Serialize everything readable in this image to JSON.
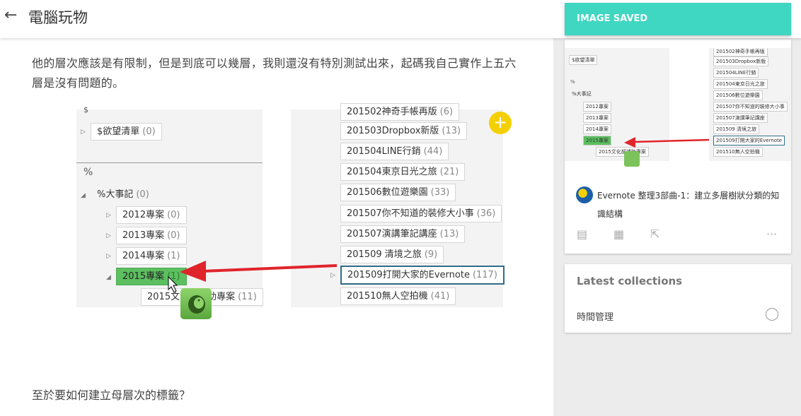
{
  "header": {
    "back_glyph": "←",
    "title": "電腦玩物"
  },
  "article": {
    "paragraph1": "他的層次應該是有限制，但是到底可以幾層，我則還沒有特別測試出來，起碼我自己實作上五六層是沒有問題的。",
    "paragraph2": "至於要如何建立母層次的標籤？"
  },
  "screenshot": {
    "left_tags": [
      {
        "name": "$欲望清單",
        "count": "(0)"
      },
      {
        "name": "%大事記",
        "count": "(0)"
      },
      {
        "name": "2012專案",
        "count": "(0)"
      },
      {
        "name": "2013專案",
        "count": "(0)"
      },
      {
        "name": "2014專案",
        "count": "(1)"
      },
      {
        "name": "2015專案",
        "count": "(1)"
      },
      {
        "name": "2015文化部補助專案",
        "count": "(11)"
      }
    ],
    "left_headers": [
      "$",
      "%"
    ],
    "right_tags": [
      {
        "name": "201502神奇手帳再版",
        "count": "(6)"
      },
      {
        "name": "201503Dropbox新版",
        "count": "(13)"
      },
      {
        "name": "201504LINE行銷",
        "count": "(44)"
      },
      {
        "name": "201504東京日光之旅",
        "count": "(21)"
      },
      {
        "name": "201506數位遊樂園",
        "count": "(33)"
      },
      {
        "name": "201507你不知道的裝修大小事",
        "count": "(36)"
      },
      {
        "name": "201507演講筆記講座",
        "count": "(13)"
      },
      {
        "name": "201509 清境之旅",
        "count": "(9)"
      },
      {
        "name": "201509打開大家的Evernote",
        "count": "(117)"
      },
      {
        "name": "201510無人空拍機",
        "count": "(41)"
      }
    ],
    "plus_glyph": "+"
  },
  "toast": {
    "label": "IMAGE SAVED"
  },
  "saved_card": {
    "title": "Evernote 整理3部曲-1：建立多層樹狀分類的知識結構",
    "actions": [
      "▤",
      "▦",
      "⇱",
      "···"
    ]
  },
  "latest": {
    "title": "Latest collections",
    "items": [
      {
        "label": "時間管理"
      }
    ]
  },
  "colors": {
    "toast": "#3fd6c2",
    "selected_tag": "#5cbf60",
    "arrow": "#e0242b",
    "plus": "#f5d000"
  }
}
